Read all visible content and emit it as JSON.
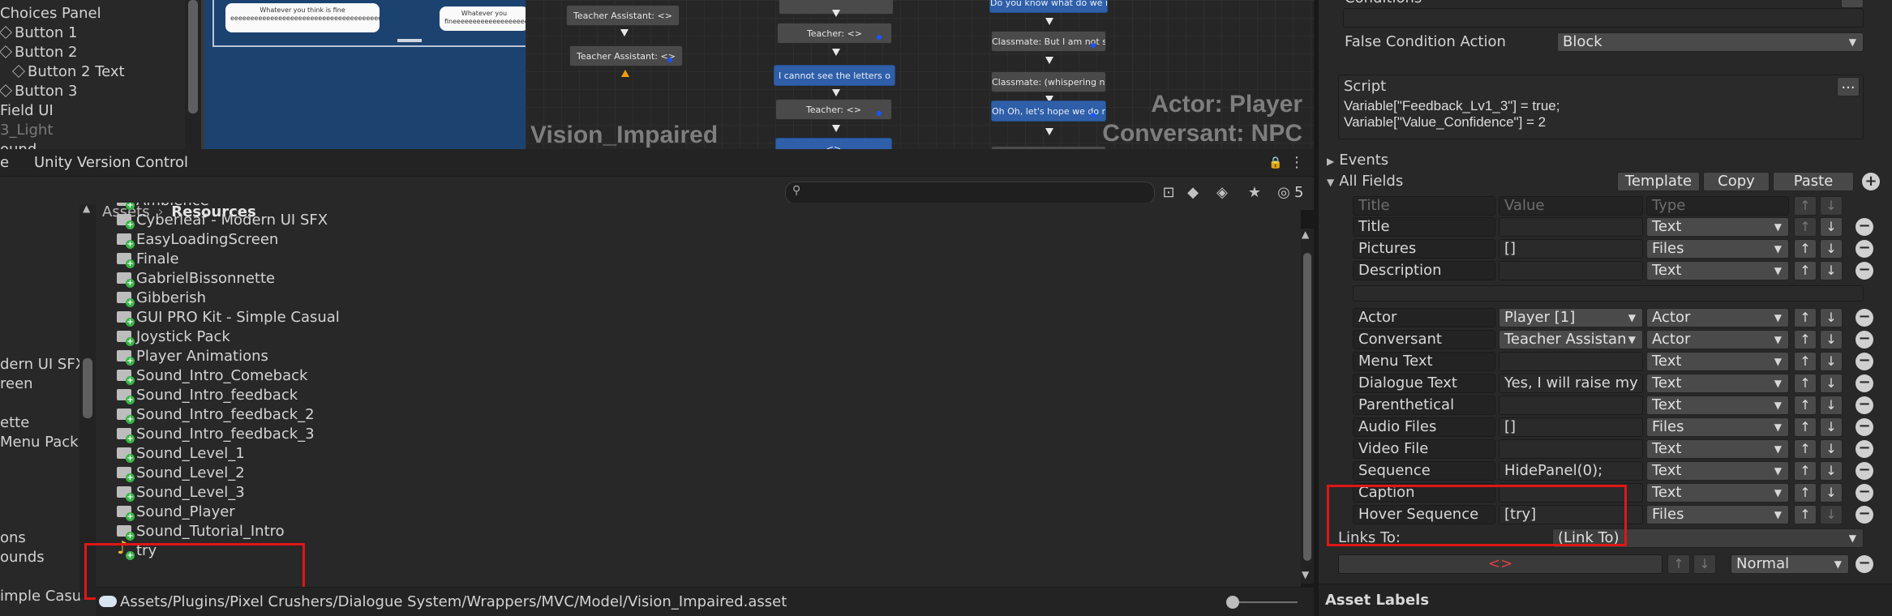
{
  "hierarchy": {
    "items": [
      "Choices Panel",
      "Button 1",
      "Button 2",
      "Button 2 Text",
      "Button 3",
      "Field UI",
      "3_Light",
      "ound"
    ]
  },
  "game_view": {
    "bubble_left": "Whatever you think is fine eeeeeeeeeeeeeeeeeeeeeeeeeeeeeeeeeeeeeeeeeeeeeeeeeeeeeeeeee",
    "bubble_right": "Whatever you fineeeeeeeeeeeeeeeeeee"
  },
  "graph": {
    "nodes": [
      "Teacher Assistant: <>",
      "Teacher Assistant: <>",
      "Teacher: <>",
      "I cannot see the letters o",
      "Teacher: <>",
      "<>",
      "Do you know what do we nee",
      "Classmate: But I am not su",
      "Classmate: (whispering noi",
      "Oh Oh, let's hope we do no"
    ],
    "title": "Vision_Impaired",
    "actor": "Actor: Player",
    "conversant": "Conversant: NPC"
  },
  "tabs": {
    "first": "e",
    "second": "Unity Version Control"
  },
  "toolbar": {
    "badge_count": "5"
  },
  "project_left": {
    "items": [
      "dern UI SFX",
      "reen",
      "ette",
      " Menu Pack",
      "ons",
      "ounds",
      "imple Casu"
    ]
  },
  "breadcrumb": {
    "root": "Assets",
    "current": "Resources"
  },
  "files": [
    {
      "name": "Ambience",
      "type": "folder"
    },
    {
      "name": "Cyberleaf - Modern UI SFX",
      "type": "folder"
    },
    {
      "name": "EasyLoadingScreen",
      "type": "folder"
    },
    {
      "name": "Finale",
      "type": "folder"
    },
    {
      "name": "GabrielBissonnette",
      "type": "folder"
    },
    {
      "name": "Gibberish",
      "type": "folder"
    },
    {
      "name": "GUI PRO Kit - Simple Casual",
      "type": "folder"
    },
    {
      "name": "Joystick Pack",
      "type": "folder"
    },
    {
      "name": "Player Animations",
      "type": "folder"
    },
    {
      "name": "Sound_Intro_Comeback",
      "type": "folder"
    },
    {
      "name": "Sound_Intro_feedback",
      "type": "folder"
    },
    {
      "name": "Sound_Intro_feedback_2",
      "type": "folder"
    },
    {
      "name": "Sound_Intro_feedback_3",
      "type": "folder"
    },
    {
      "name": "Sound_Level_1",
      "type": "folder"
    },
    {
      "name": "Sound_Level_2",
      "type": "folder"
    },
    {
      "name": "Sound_Level_3",
      "type": "folder"
    },
    {
      "name": "Sound_Player",
      "type": "folder"
    },
    {
      "name": "Sound_Tutorial_Intro",
      "type": "folder"
    },
    {
      "name": "try",
      "type": "audio"
    }
  ],
  "status": {
    "path": "Assets/Plugins/Pixel Crushers/Dialogue System/Wrappers/MVC/Model/Vision_Impaired.asset"
  },
  "inspector": {
    "conditions_label": "Conditions",
    "false_condition_label": "False Condition Action",
    "false_condition_value": "Block",
    "script_label": "Script",
    "script_more": "...",
    "script_text": "Variable[\"Feedback_Lv1_3\"] = true;\nVariable[\"Value_Confidence\"] = 2",
    "events_label": "Events",
    "all_fields_label": "All Fields",
    "template_btn": "Template",
    "copy_btn": "Copy",
    "paste_btn": "Paste",
    "header": {
      "title": "Title",
      "value": "Value",
      "type": "Type"
    },
    "fields": [
      {
        "title": "Title",
        "value": "",
        "type": "Text",
        "value_dropdown": false
      },
      {
        "title": "Pictures",
        "value": "[]",
        "type": "Files",
        "value_dropdown": false
      },
      {
        "title": "Description",
        "value": "",
        "type": "Text",
        "value_dropdown": false
      },
      {
        "title": "Actor",
        "value": "Player [1]",
        "type": "Actor",
        "value_dropdown": true
      },
      {
        "title": "Conversant",
        "value": "Teacher Assistan",
        "type": "Actor",
        "value_dropdown": true
      },
      {
        "title": "Menu Text",
        "value": "",
        "type": "Text",
        "value_dropdown": false
      },
      {
        "title": "Dialogue Text",
        "value": "Yes, I will raise my",
        "type": "Text",
        "value_dropdown": false
      },
      {
        "title": "Parenthetical",
        "value": "",
        "type": "Text",
        "value_dropdown": false
      },
      {
        "title": "Audio Files",
        "value": "[]",
        "type": "Files",
        "value_dropdown": false
      },
      {
        "title": "Video File",
        "value": "",
        "type": "Text",
        "value_dropdown": false
      },
      {
        "title": "Sequence",
        "value": "HidePanel(0);",
        "type": "Text",
        "value_dropdown": false
      },
      {
        "title": "Caption",
        "value": "",
        "type": "Text",
        "value_dropdown": false
      },
      {
        "title": "Hover Sequence",
        "value": "[try]",
        "type": "Files",
        "value_dropdown": false
      }
    ],
    "links_to_label": "Links To:",
    "links_to_value": "(Link To)",
    "link_entry": "<>",
    "link_priority": "Normal",
    "asset_labels": "Asset Labels"
  }
}
